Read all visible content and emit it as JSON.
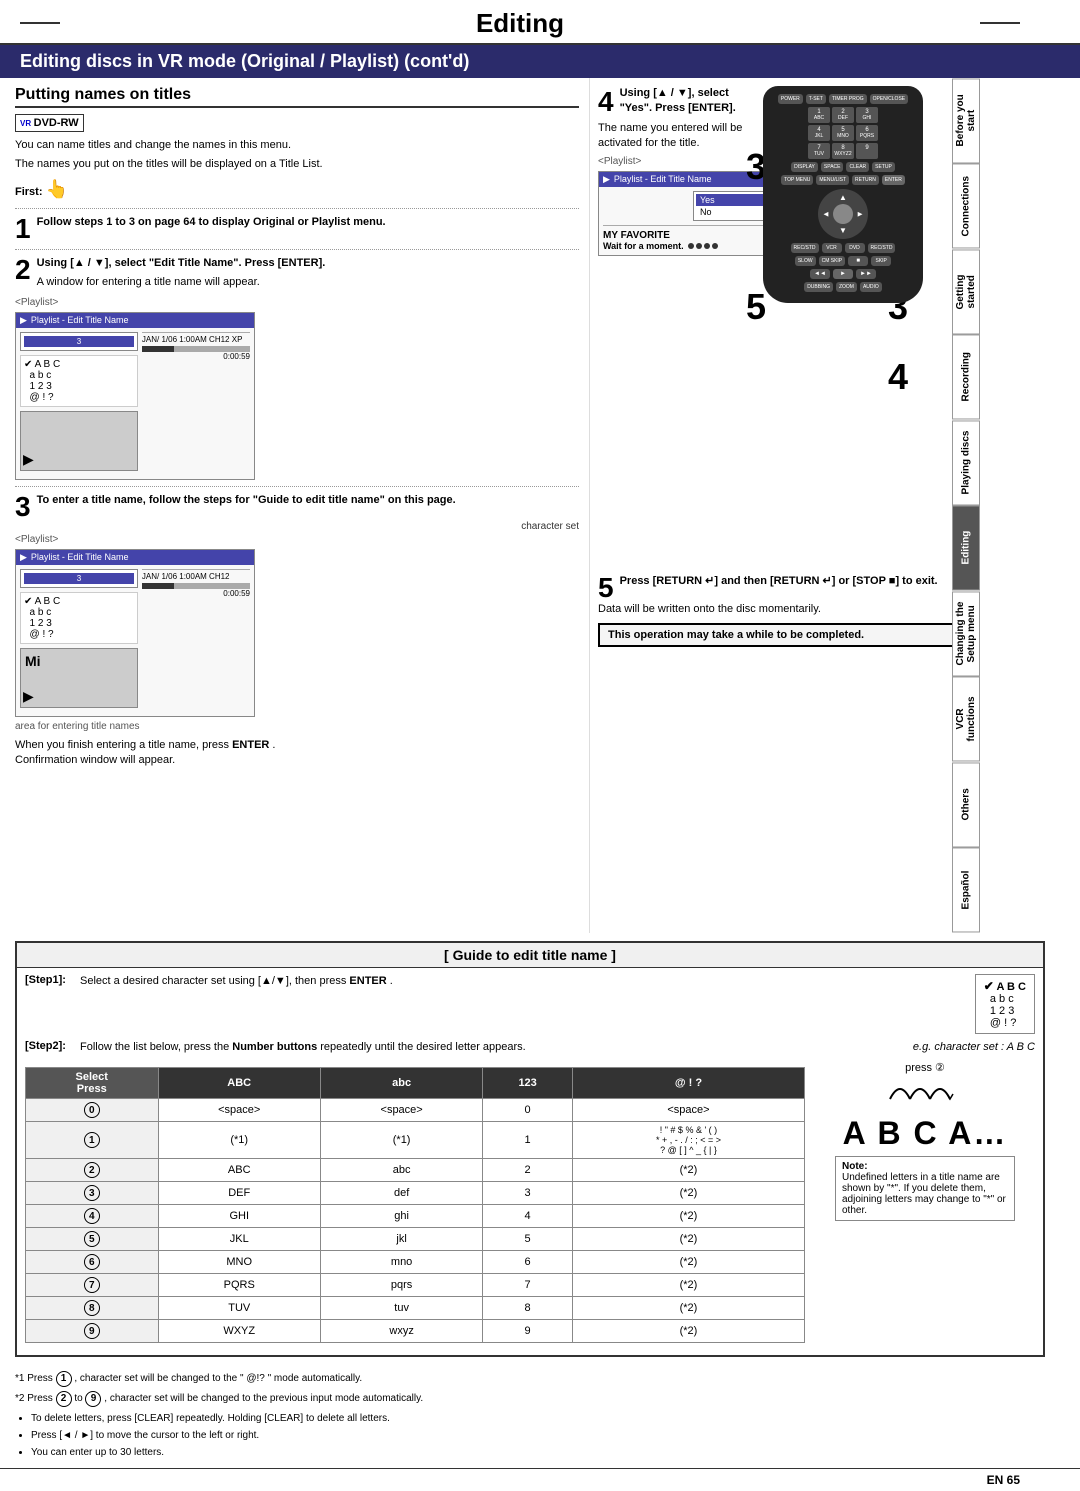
{
  "page": {
    "title": "Editing",
    "subtitle": "Editing discs in VR mode (Original / Playlist) (cont'd)",
    "section_heading": "Putting names on titles",
    "footer_text": "EN  65"
  },
  "sidebar": {
    "tabs": [
      {
        "label": "Before you start",
        "active": false
      },
      {
        "label": "Connections",
        "active": false
      },
      {
        "label": "Getting started",
        "active": false
      },
      {
        "label": "Recording",
        "active": false
      },
      {
        "label": "Playing discs",
        "active": false
      },
      {
        "label": "Editing",
        "active": true
      },
      {
        "label": "Changing the Setup menu",
        "active": false
      },
      {
        "label": "VCR functions",
        "active": false
      },
      {
        "label": "Others",
        "active": false
      },
      {
        "label": "Español",
        "active": false
      }
    ]
  },
  "intro": {
    "text1": "You can name titles and change the names in this menu.",
    "text2": "The names you put on the titles will be displayed on a Title List.",
    "first_label": "First:"
  },
  "step1": {
    "number": "1",
    "instruction": "Follow steps 1 to 3 on page 64 to display Original or Playlist menu."
  },
  "step2": {
    "number": "2",
    "instruction": "Using [▲ / ▼], select \"Edit Title Name\". Press [ENTER].",
    "sub": "A window for entering a title name will appear.",
    "playlist_label": "<Playlist>",
    "screenshot_title": "Playlist - Edit Title Name",
    "char_set_chars": "✔ A B C\n  a b c\n  1 2 3\n  @ ! ?",
    "meta": "JAN/ 1/06 1:00AM CH12 XP",
    "time": "0:00:59"
  },
  "step3": {
    "number": "3",
    "instruction": "To enter a title name, follow the steps for \"Guide to edit title name\" on this page.",
    "sub_label": "character set",
    "playlist_label": "<Playlist>",
    "screenshot_title": "Playlist - Edit Title Name",
    "area_label": "area for entering title names",
    "time": "0:00:59",
    "preview_text": "Mi"
  },
  "step4": {
    "number": "4",
    "sub_step": "Using [▲ / ▼], select \"Yes\". Press [ENTER].",
    "sub_desc": "The name you entered will be activated for the title.",
    "playlist_label": "<Playlist>",
    "screenshot_title": "Playlist - Edit Title Name",
    "favorite_text": "MY FAVORITE",
    "wait_text": "Wait for a moment."
  },
  "step5": {
    "number": "5",
    "instruction": "Press [RETURN ↵] and then [RETURN ↵] or [STOP ■] to exit.",
    "sub": "Data will be written onto the disc momentarily."
  },
  "info_box": {
    "text": "This operation may take a while to be completed."
  },
  "finish_note": {
    "text1": "When you finish entering a title name, press",
    "bold": "ENTER",
    "text2": ".",
    "text3": "Confirmation window will appear."
  },
  "guide": {
    "title": "[ Guide to edit title name ]",
    "step1_label": "[Step1]:",
    "step1_text": "Select a desired character set using [▲/▼], then press",
    "step1_bold": "ENTER",
    "step1_text2": ".",
    "step2_label": "[Step2]:",
    "step2_text": "Follow the list below, press the",
    "step2_bold": "Number buttons",
    "step2_text2": "repeatedly until the desired letter appears.",
    "step2_eg": "e.g. character set :  A B C"
  },
  "charset_box": {
    "check": "✔",
    "lines": [
      "A B C",
      "a b c",
      "1 2 3",
      "@ ! ?"
    ]
  },
  "press2_label": "press ②",
  "abc_display": "A B C A…",
  "char_table": {
    "headers": [
      "Select",
      "ABC",
      "abc",
      "123",
      "@ ! ?"
    ],
    "press_header": "Press",
    "rows": [
      {
        "num": "0",
        "circle": true,
        "abc": "<space>",
        "abc_l": "<space>",
        "n123": "0",
        "sym": "<space>"
      },
      {
        "num": "1",
        "circle": true,
        "abc": "(*1)",
        "abc_l": "(*1)",
        "n123": "1",
        "sym": "! \" # $ % & ' ( )\n* + , - . / : ; < = >\n? @ [ ] ^ _ { | }"
      },
      {
        "num": "2",
        "circle": true,
        "abc": "ABC",
        "abc_l": "abc",
        "n123": "2",
        "sym": "(*2)"
      },
      {
        "num": "3",
        "circle": true,
        "abc": "DEF",
        "abc_l": "def",
        "n123": "3",
        "sym": "(*2)"
      },
      {
        "num": "4",
        "circle": true,
        "abc": "GHI",
        "abc_l": "ghi",
        "n123": "4",
        "sym": "(*2)"
      },
      {
        "num": "5",
        "circle": true,
        "abc": "JKL",
        "abc_l": "jkl",
        "n123": "5",
        "sym": "(*2)"
      },
      {
        "num": "6",
        "circle": true,
        "abc": "MNO",
        "abc_l": "mno",
        "n123": "6",
        "sym": "(*2)"
      },
      {
        "num": "7",
        "circle": true,
        "abc": "PQRS",
        "abc_l": "pqrs",
        "n123": "7",
        "sym": "(*2)"
      },
      {
        "num": "8",
        "circle": true,
        "abc": "TUV",
        "abc_l": "tuv",
        "n123": "8",
        "sym": "(*2)"
      },
      {
        "num": "9",
        "circle": true,
        "abc": "WXYZ",
        "abc_l": "wxyz",
        "n123": "9",
        "sym": "(*2)"
      }
    ]
  },
  "note_box": {
    "lines": [
      "Undefined letters in a title name are shown by \"*\". If you delete them, adjoining letters may change to \"*\" or other."
    ]
  },
  "bottom_notes": {
    "note1_prefix": "*1 Press ",
    "note1_num": "①",
    "note1_text": ", character set will be changed to the \" @!? \" mode automatically.",
    "note2_prefix": "*2 Press ",
    "note2_num": "②",
    "note2_text_mid": " to ",
    "note2_num2": "⑨",
    "note2_text": ", character set will be changed to the previous input mode automatically.",
    "bullets": [
      "To delete letters, press [CLEAR] repeatedly. Holding [CLEAR] to delete all letters.",
      "Press [◄ / ►] to move the cursor to the left or right.",
      "You can enter up to 30 letters."
    ]
  }
}
